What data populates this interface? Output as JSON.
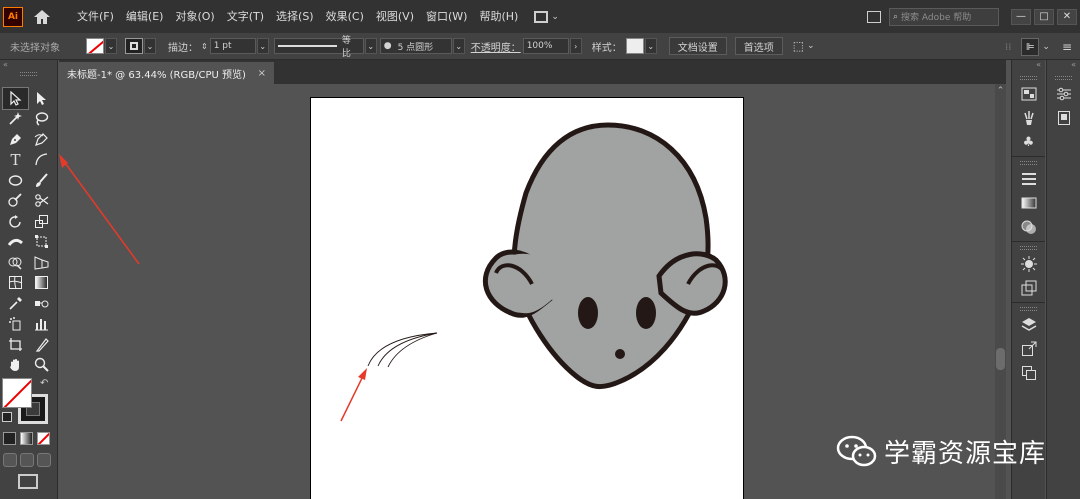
{
  "app": {
    "logo": "Ai"
  },
  "menu": [
    "文件(F)",
    "编辑(E)",
    "对象(O)",
    "文字(T)",
    "选择(S)",
    "效果(C)",
    "视图(V)",
    "窗口(W)",
    "帮助(H)"
  ],
  "search": {
    "placeholder": "搜索 Adobe 帮助"
  },
  "window_buttons": [
    "—",
    "□",
    "✕"
  ],
  "control": {
    "selection_status": "未选择对象",
    "stroke_label": "描边：",
    "stroke_weight": "1 pt",
    "stroke_profile": "等比",
    "brush": "5 点圆形",
    "opacity_label": "不透明度：",
    "opacity_value": "100%",
    "style_label": "样式：",
    "doc_setup": "文档设置",
    "preferences": "首选项"
  },
  "document": {
    "tab_title": "未标题-1* @ 63.44% (RGB/CPU 预览)",
    "close": "×"
  },
  "colors": {
    "mouse_fill": "#a0a3a1",
    "mouse_stroke": "#231815",
    "arrow": "#e53a2a",
    "fill_none": "#ee0000"
  },
  "tools": [
    "selection-tool",
    "direct-selection-tool",
    "magic-wand-tool",
    "lasso-tool",
    "pen-tool",
    "curvature-tool",
    "type-tool",
    "line-segment-tool",
    "ellipse-tool",
    "paintbrush-tool",
    "shaper-tool",
    "scissors-tool",
    "rotate-tool",
    "scale-tool",
    "width-tool",
    "free-transform-tool",
    "shape-builder-tool",
    "perspective-grid-tool",
    "mesh-tool",
    "gradient-tool",
    "eyedropper-tool",
    "blend-tool",
    "symbol-sprayer-tool",
    "column-graph-tool",
    "artboard-tool",
    "slice-tool",
    "hand-tool",
    "zoom-tool"
  ],
  "watermark": {
    "text": "学霸资源宝库",
    "icon": "wechat-icon"
  }
}
